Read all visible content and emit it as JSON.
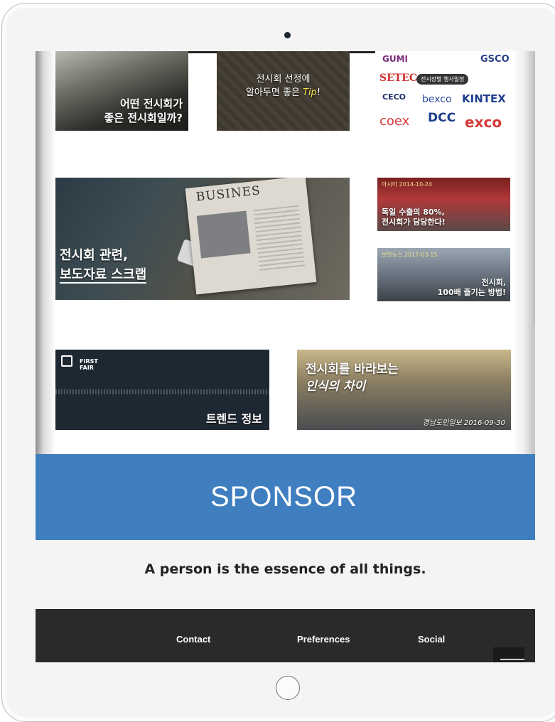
{
  "tiles": {
    "exhibition_quality": {
      "line1": "어떤 전시회가",
      "line2": "좋은 전시회일까?"
    },
    "exhibition_tip": {
      "line1": "전시회 선정에",
      "line2_prefix": "알아두면 좋은 ",
      "tip": "Tip",
      "suffix": "!"
    },
    "venues": {
      "logos": [
        "GUMI",
        "GSCO",
        "SETEC",
        "CECO",
        "bexco",
        "KINTEX",
        "coex",
        "DCC",
        "exco"
      ],
      "schedule_badge": "전시장별 행사일정"
    },
    "press_scrap": {
      "newspaper_head": "BUSINES",
      "line1": "전시회 관련,",
      "line2": "보도자료 스크랩"
    },
    "export_share": {
      "source": "아시아 2014-10-24",
      "line1": "독일 수출의 80%,",
      "line2": "전시회가 담당한다!"
    },
    "enjoy_exhibition": {
      "source": "보안뉴스 2017-03-15",
      "line1": "전시회,",
      "line2": "100배 즐기는 방법!"
    },
    "trend": {
      "brand_line1": "FIRST",
      "brand_line2": "FAIR",
      "title": "트렌드 정보"
    },
    "perception": {
      "line1": "전시회를 바라보는",
      "line2": "인식의 차이",
      "credit": "경남도민일보 2016-09-30"
    }
  },
  "sponsor": {
    "title": "SPONSOR"
  },
  "motto": "A person is the essence of all things.",
  "footer": {
    "links": [
      "Contact",
      "Preferences",
      "Social"
    ]
  },
  "colors": {
    "sponsor_blue": "#3f7fc0",
    "footer_bg": "#2a2a2a",
    "tip_yellow": "#f5e04a"
  }
}
